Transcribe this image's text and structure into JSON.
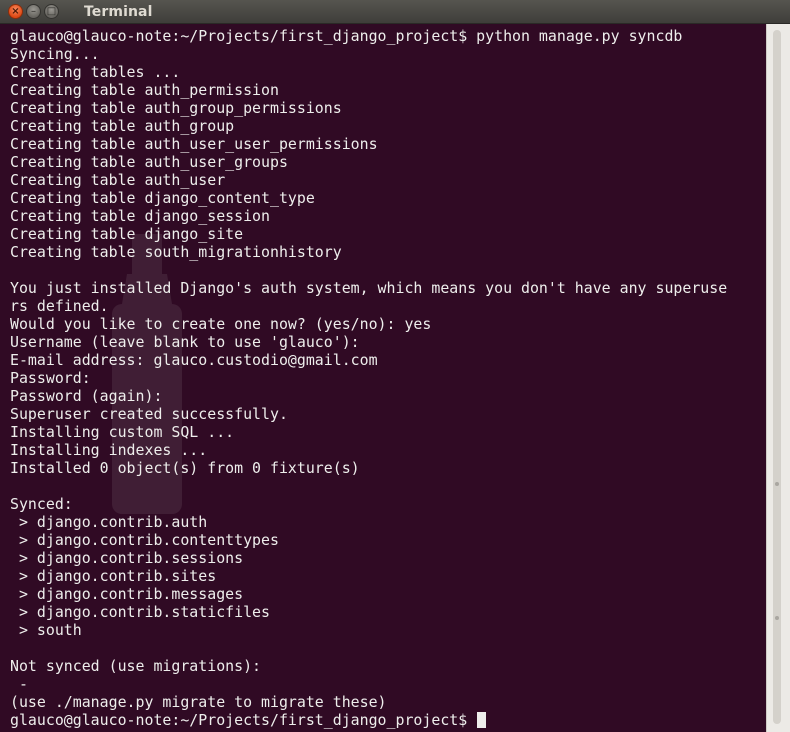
{
  "window": {
    "title": "Terminal",
    "controls": {
      "close_glyph": "×",
      "minimize_glyph": "–",
      "maximize_glyph": "□"
    }
  },
  "terminal": {
    "colors": {
      "background": "#300a24",
      "foreground": "#eeeeec"
    },
    "lines": [
      "glauco@glauco-note:~/Projects/first_django_project$ python manage.py syncdb",
      "Syncing...",
      "Creating tables ...",
      "Creating table auth_permission",
      "Creating table auth_group_permissions",
      "Creating table auth_group",
      "Creating table auth_user_user_permissions",
      "Creating table auth_user_groups",
      "Creating table auth_user",
      "Creating table django_content_type",
      "Creating table django_session",
      "Creating table django_site",
      "Creating table south_migrationhistory",
      "",
      "You just installed Django's auth system, which means you don't have any superuse",
      "rs defined.",
      "Would you like to create one now? (yes/no): yes",
      "Username (leave blank to use 'glauco'):",
      "E-mail address: glauco.custodio@gmail.com",
      "Password:",
      "Password (again):",
      "Superuser created successfully.",
      "Installing custom SQL ...",
      "Installing indexes ...",
      "Installed 0 object(s) from 0 fixture(s)",
      "",
      "Synced:",
      " > django.contrib.auth",
      " > django.contrib.contenttypes",
      " > django.contrib.sessions",
      " > django.contrib.sites",
      " > django.contrib.messages",
      " > django.contrib.staticfiles",
      " > south",
      "",
      "Not synced (use migrations):",
      " - ",
      "(use ./manage.py migrate to migrate these)"
    ],
    "prompt": "glauco@glauco-note:~/Projects/first_django_project$ "
  }
}
